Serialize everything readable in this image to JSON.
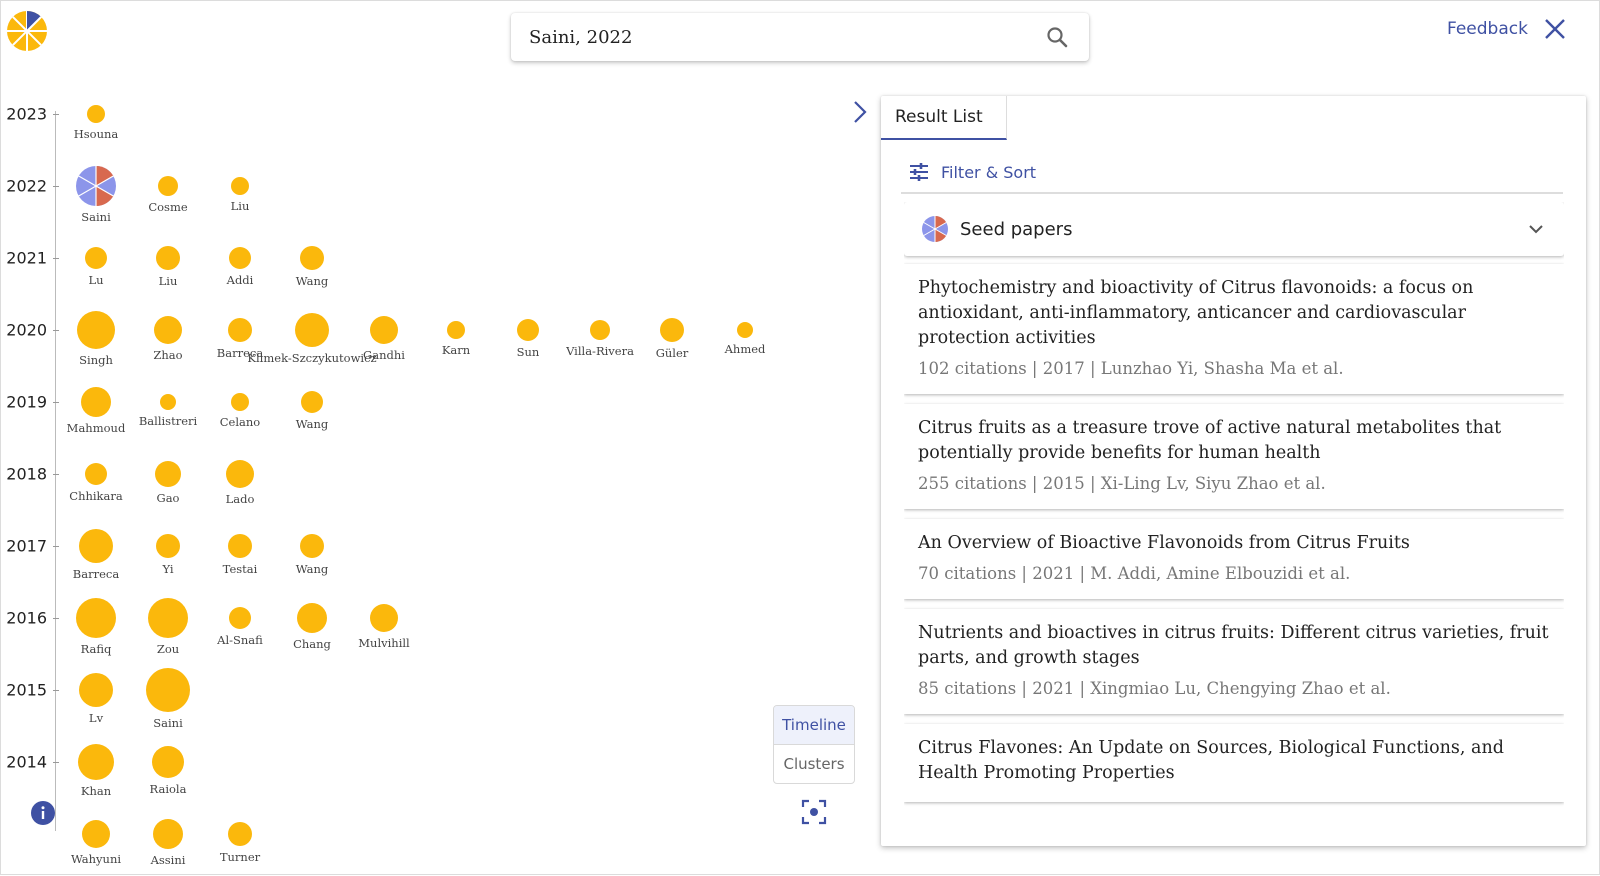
{
  "search": {
    "value": "Saini, 2022"
  },
  "header": {
    "feedback": "Feedback"
  },
  "colors": {
    "accent": "#3f51a3",
    "node": "#fbb80c",
    "seed_red": "#d8694f",
    "seed_blue": "#8c95ea"
  },
  "timeline": {
    "years": [
      "2023",
      "2022",
      "2021",
      "2020",
      "2019",
      "2018",
      "2017",
      "2016",
      "2015",
      "2014"
    ],
    "rows": [
      {
        "year": "2023",
        "papers": [
          {
            "label": "Hsouna"
          }
        ]
      },
      {
        "year": "2022",
        "papers": [
          {
            "label": "Saini",
            "seed": true
          },
          {
            "label": "Cosme"
          },
          {
            "label": "Liu"
          }
        ]
      },
      {
        "year": "2021",
        "papers": [
          {
            "label": "Lu"
          },
          {
            "label": "Liu"
          },
          {
            "label": "Addi"
          },
          {
            "label": "Wang"
          }
        ]
      },
      {
        "year": "2020",
        "papers": [
          {
            "label": "Singh"
          },
          {
            "label": "Zhao"
          },
          {
            "label": "Barreca"
          },
          {
            "label": "Klimek-Szczykutowicz"
          },
          {
            "label": "Gandhi"
          },
          {
            "label": "Karn"
          },
          {
            "label": "Sun"
          },
          {
            "label": "Villa-Rivera"
          },
          {
            "label": "Güler"
          },
          {
            "label": "Ahmed"
          }
        ]
      },
      {
        "year": "2019",
        "papers": [
          {
            "label": "Mahmoud"
          },
          {
            "label": "Ballistreri"
          },
          {
            "label": "Celano"
          },
          {
            "label": "Wang"
          }
        ]
      },
      {
        "year": "2018",
        "papers": [
          {
            "label": "Chhikara"
          },
          {
            "label": "Gao"
          },
          {
            "label": "Lado"
          }
        ]
      },
      {
        "year": "2017",
        "papers": [
          {
            "label": "Barreca"
          },
          {
            "label": "Yi"
          },
          {
            "label": "Testai"
          },
          {
            "label": "Wang"
          }
        ]
      },
      {
        "year": "2016",
        "papers": [
          {
            "label": "Rafiq"
          },
          {
            "label": "Zou"
          },
          {
            "label": "Al-Snafi"
          },
          {
            "label": "Chang"
          },
          {
            "label": "Mulvihill"
          }
        ]
      },
      {
        "year": "2015",
        "papers": [
          {
            "label": "Lv"
          },
          {
            "label": "Saini"
          }
        ]
      },
      {
        "year": "2014",
        "papers": [
          {
            "label": "Khan"
          },
          {
            "label": "Raiola"
          }
        ]
      },
      {
        "year": "",
        "papers": [
          {
            "label": "Wahyuni"
          },
          {
            "label": "Assini"
          },
          {
            "label": "Turner"
          }
        ]
      }
    ]
  },
  "view_toggle": {
    "timeline": "Timeline",
    "clusters": "Clusters"
  },
  "panel": {
    "tab": "Result List",
    "filter_label": "Filter & Sort",
    "seed_header": "Seed papers",
    "results": [
      {
        "title": "Phytochemistry and bioactivity of Citrus flavonoids: a focus on antioxidant, anti-inflammatory, anticancer and cardiovascular protection activities",
        "meta": "102 citations | 2017 | Lunzhao Yi, Shasha Ma et al."
      },
      {
        "title": "Citrus fruits as a treasure trove of active natural metabolites that potentially provide benefits for human health",
        "meta": "255 citations | 2015 | Xi-Ling Lv, Siyu Zhao et al."
      },
      {
        "title": "An Overview of Bioactive Flavonoids from Citrus Fruits",
        "meta": "70 citations | 2021 | M. Addi, Amine Elbouzidi et al."
      },
      {
        "title": "Nutrients and bioactives in citrus fruits: Different citrus varieties, fruit parts, and growth stages",
        "meta": "85 citations | 2021 | Xingmiao Lu, Chengying Zhao et al."
      },
      {
        "title": "Citrus Flavones: An Update on Sources, Biological Functions, and Health Promoting Properties",
        "meta": ""
      }
    ]
  }
}
